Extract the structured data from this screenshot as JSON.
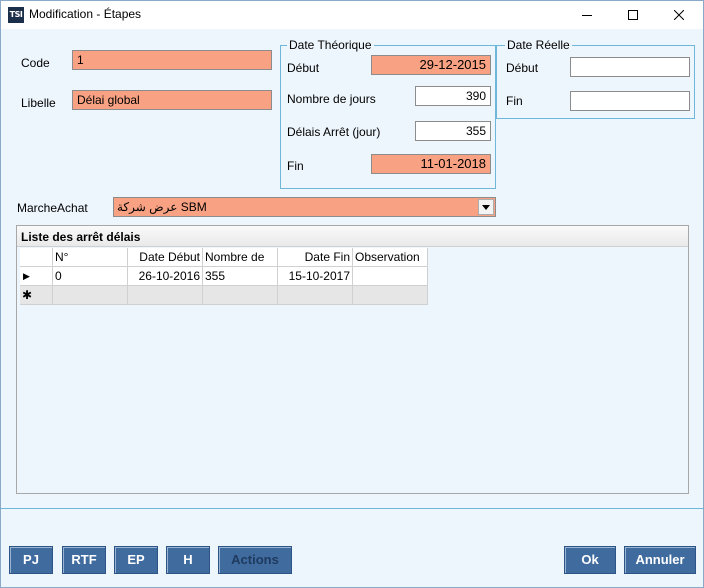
{
  "window": {
    "title": "Modification - Étapes",
    "icon_text": "TSI"
  },
  "form": {
    "code_label": "Code",
    "code_value": "1",
    "libelle_label": "Libelle",
    "libelle_value": "Délai global",
    "marche_label": "MarcheAchat",
    "marche_value": "عرض شركة SBM"
  },
  "theorique": {
    "title": "Date Théorique",
    "debut_label": "Début",
    "debut_value": "29-12-2015",
    "jours_label": "Nombre de jours",
    "jours_value": "390",
    "arret_label": "Délais Arrêt (jour)",
    "arret_value": "355",
    "fin_label": "Fin",
    "fin_value": "11-01-2018"
  },
  "reelle": {
    "title": "Date Réelle",
    "debut_label": "Début",
    "debut_value": "",
    "fin_label": "Fin",
    "fin_value": ""
  },
  "list": {
    "title": "Liste des arrêt délais",
    "columns": [
      "N°",
      "Date Début",
      "Nombre de",
      "Date Fin",
      "Observation"
    ],
    "rows": [
      [
        "0",
        "26-10-2016",
        "355",
        "15-10-2017",
        ""
      ]
    ],
    "current_row_marker": "▶",
    "new_row_marker": "✱"
  },
  "buttons": {
    "pj": "PJ",
    "rtf": "RTF",
    "ep": "EP",
    "h": "H",
    "actions": "Actions",
    "ok": "Ok",
    "annuler": "Annuler"
  },
  "colors": {
    "required_field": "#f9a283",
    "button": "#3f6b9f",
    "group_border": "#6fb7d8"
  }
}
